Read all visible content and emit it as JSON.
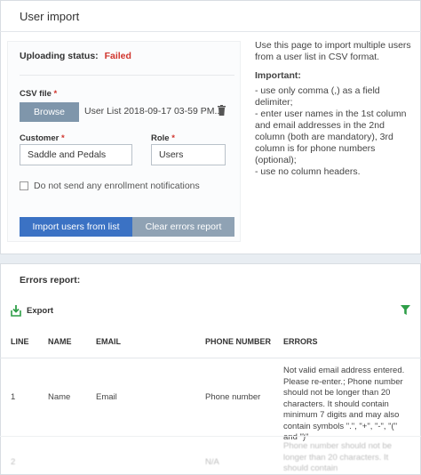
{
  "page": {
    "title": "User import"
  },
  "form": {
    "status_label": "Uploading status:",
    "status_value": "Failed",
    "csv_label": "CSV file",
    "browse_label": "Browse",
    "file_name": "User List 2018-09-17 03-59 PM....",
    "customer_label": "Customer",
    "customer_value": "Saddle and Pedals",
    "role_label": "Role",
    "role_value": "Users",
    "notify_label": "Do not send any enrollment notifications",
    "required_mark": "*",
    "import_button": "Import users from list",
    "clear_button": "Clear errors report"
  },
  "help": {
    "intro": "Use this page to import multiple users from a user list in CSV format.",
    "important": "Important:",
    "rules": [
      "- use only comma (,) as a field delimiter;",
      "- enter user names in the 1st column and email addresses in the 2nd column (both are mandatory), 3rd column is for phone numbers (optional);",
      "- use no column headers."
    ]
  },
  "errors": {
    "title": "Errors report:",
    "export_label": "Export",
    "columns": [
      "LINE",
      "NAME",
      "EMAIL",
      "PHONE NUMBER",
      "ERRORS"
    ],
    "rows": [
      {
        "line": "1",
        "name": "Name",
        "email": "Email",
        "phone": "Phone number",
        "error": "Not valid email address entered. Please re-enter.; Phone number should not be longer than 20 characters. It should contain minimum 7 digits and may also contain symbols \".\", \"+\", \"-\", \"(\" and \")\""
      },
      {
        "line": "2",
        "name": "",
        "email": "",
        "phone": "N/A",
        "error": "Phone number should not be longer than 20 characters. It should contain"
      }
    ]
  },
  "colors": {
    "accent": "#3b72c4",
    "failed": "#d0342c",
    "export_green": "#2e9e48"
  },
  "icons": [
    "trash-icon",
    "export-icon",
    "filter-icon"
  ]
}
